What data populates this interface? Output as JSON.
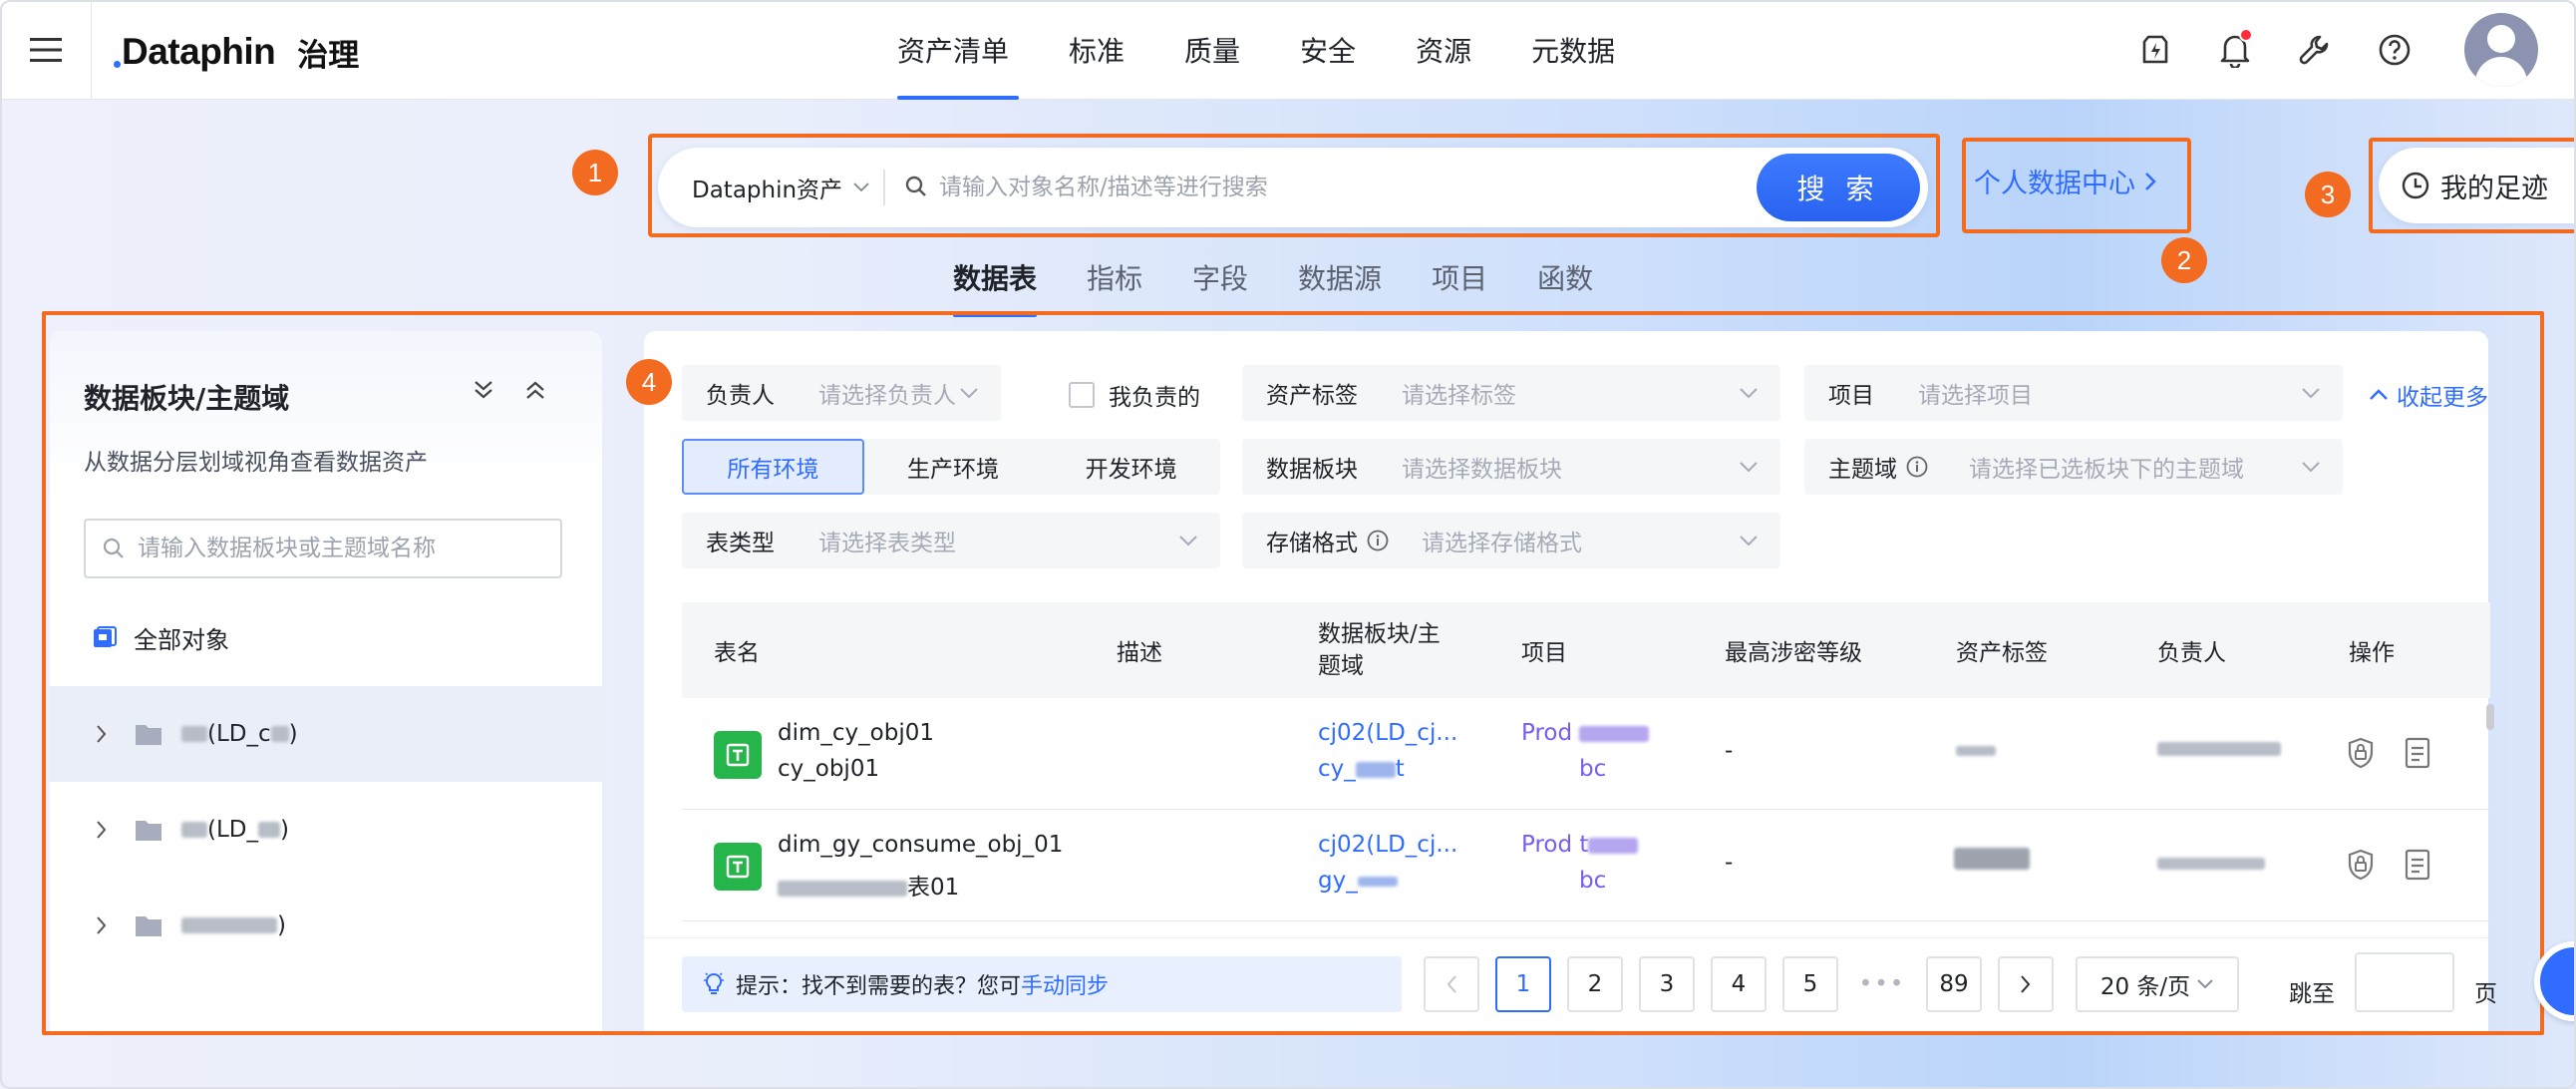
{
  "app": {
    "brand": "Dataphin",
    "product": "治理"
  },
  "nav": {
    "items": [
      "资产清单",
      "标准",
      "质量",
      "安全",
      "资源",
      "元数据"
    ],
    "active": "资产清单"
  },
  "top_icons": [
    "flash-icon",
    "bell-icon",
    "wrench-icon",
    "help-icon",
    "avatar"
  ],
  "search": {
    "scope": "Dataphin资产",
    "placeholder": "请输入对象名称/描述等进行搜索",
    "button": "搜 索"
  },
  "personal_center": "个人数据中心",
  "footprint": "我的足迹",
  "markers": [
    "1",
    "2",
    "3",
    "4"
  ],
  "category_tabs": [
    "数据表",
    "指标",
    "字段",
    "数据源",
    "项目",
    "函数"
  ],
  "left_panel": {
    "title": "数据板块/主题域",
    "description": "从数据分层划域视角查看数据资产",
    "search_placeholder": "请输入数据板块或主题域名称",
    "all_objects": "全部对象",
    "tree": [
      {
        "label": "c   (LD_c   )"
      },
      {
        "label": "c   (LD_   )"
      },
      {
        "label": ")"
      }
    ]
  },
  "filters": {
    "owner": {
      "label": "负责人",
      "placeholder": "请选择负责人"
    },
    "mine": "我负责的",
    "asset_tag": {
      "label": "资产标签",
      "placeholder": "请选择标签"
    },
    "project": {
      "label": "项目",
      "placeholder": "请选择项目"
    },
    "collapse": "收起更多",
    "env": [
      "所有环境",
      "生产环境",
      "开发环境"
    ],
    "env_active": "所有环境",
    "block": {
      "label": "数据板块",
      "placeholder": "请选择数据板块"
    },
    "subject": {
      "label": "主题域",
      "placeholder": "请选择已选板块下的主题域"
    },
    "table_type": {
      "label": "表类型",
      "placeholder": "请选择表类型"
    },
    "storage": {
      "label": "存储格式",
      "placeholder": "请选择存储格式"
    }
  },
  "table": {
    "columns": [
      "表名",
      "描述",
      "数据板块/",
      "题域",
      "项目",
      "最高涉密等级",
      "资产标签",
      "负责人",
      "操作"
    ],
    "column_block_line1": "数据板块/主",
    "rows": [
      {
        "name": "dim_cy_obj01",
        "sub": "cy_obj01",
        "domain1": "cj02(LD_cj...",
        "domain2": "cy_     t",
        "project1": "Prod",
        "project2": "bc",
        "level": "-"
      },
      {
        "name": "dim_gy_consume_obj_01",
        "sub": "表01",
        "domain1": "cj02(LD_cj...",
        "domain2": "gy_",
        "project1": "Prod t",
        "project2": "bc",
        "level": "-"
      }
    ]
  },
  "footer": {
    "tip_prefix": "提示：找不到需要的表？您可",
    "tip_link": "手动同步",
    "pages": [
      "1",
      "2",
      "3",
      "4",
      "5",
      "•••",
      "89"
    ],
    "current_page": "1",
    "page_size": "20 条/页",
    "jump_label": "跳至",
    "page_label": "页"
  },
  "colors": {
    "accent": "#2f6cff",
    "annotation": "#f26b21",
    "table_icon": "#26b54a",
    "project_text": "#7b5cf0"
  }
}
